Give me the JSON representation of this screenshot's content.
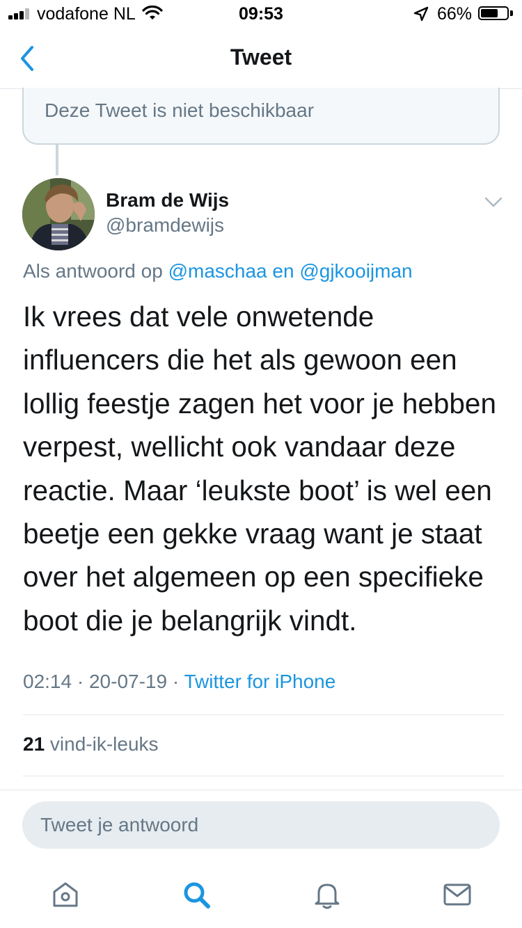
{
  "status_bar": {
    "carrier": "vodafone NL",
    "time": "09:53",
    "battery_percent": "66%",
    "battery_level": 0.66,
    "signal_bars": 3,
    "icons": [
      "signal-icon",
      "wifi-icon",
      "location-arrow-icon",
      "battery-icon"
    ]
  },
  "nav": {
    "title": "Tweet",
    "back_icon": "chevron-left-icon"
  },
  "unavailable_notice": "Deze Tweet is niet beschikbaar",
  "tweet": {
    "author_name": "Bram de Wijs",
    "author_handle": "@bramdewijs",
    "reply_prefix": "Als antwoord op ",
    "reply_mention_1": "@maschaa",
    "reply_conjunction": " en ",
    "reply_mention_2": "@gjkooijman",
    "text_lines": [
      "Ik vrees dat vele onwetende",
      "influencers die het als gewoon een",
      "lollig feestje zagen het voor je hebben",
      "verpest, wellicht ook vandaar deze",
      "reactie. Maar ‘leukste boot’ is wel een",
      "beetje een gekke vraag want je staat",
      "over het algemeen op een specifieke",
      "boot die je belangrijk vindt."
    ],
    "time": "02:14",
    "separator": " · ",
    "date": "20-07-19",
    "source": "Twitter for iPhone",
    "likes_count": "21",
    "likes_label": " vind-ik-leuks"
  },
  "reply_input": {
    "placeholder": "Tweet je antwoord"
  },
  "tab_bar": {
    "items": [
      "home-icon",
      "search-icon",
      "notifications-icon",
      "messages-icon"
    ],
    "active": "search-icon"
  },
  "colors": {
    "accent": "#1b95e0",
    "secondary_text": "#657786",
    "primary_text": "#14171a",
    "divider": "#e1e8ed"
  }
}
